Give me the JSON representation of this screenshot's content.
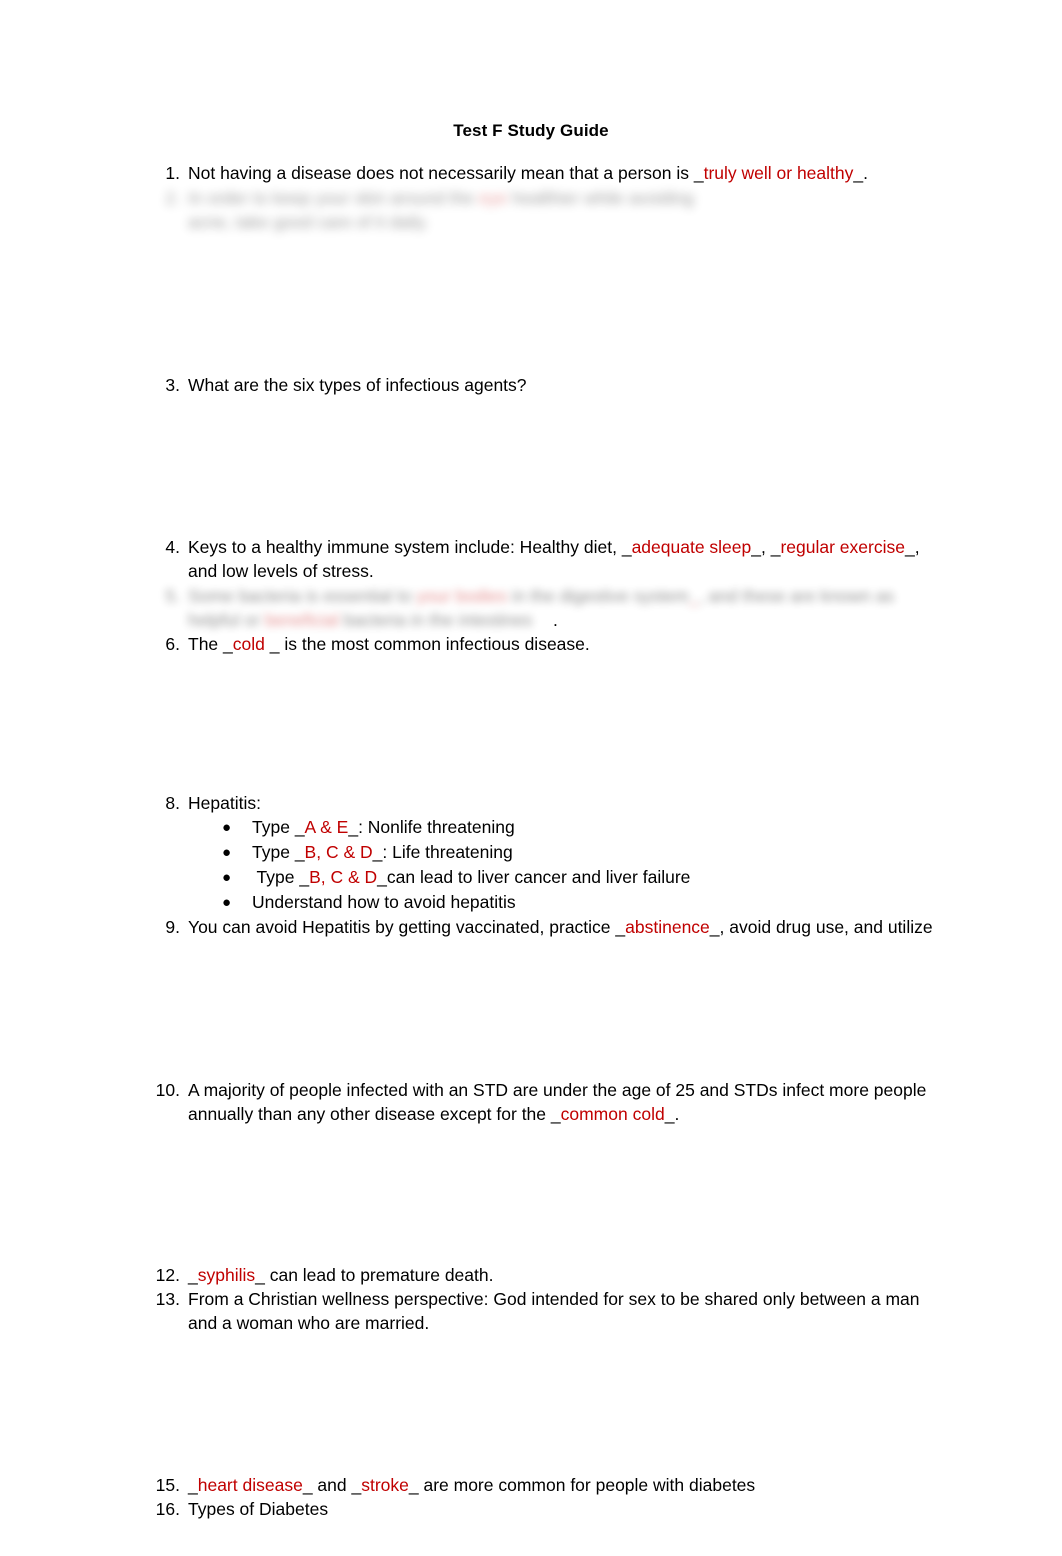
{
  "document": {
    "title": "Test F Study Guide",
    "accent_color": "#C00000",
    "text_color": "#000000",
    "background_color": "#FFFFFF"
  },
  "items": {
    "i1": {
      "number": "1.",
      "pre": "Not having a disease does not necessarily mean that a person is ",
      "u1": "_",
      "answer": "truly well or healthy",
      "u2": "_",
      "post": "."
    },
    "i2": {
      "number": "2.",
      "line1_pre": "In order to keep your skin around the ",
      "answer": "eye",
      "line1_post": " healthier while avoiding",
      "line2": "acne, take good care of it daily."
    },
    "i3": {
      "number": "3.",
      "text": "What are the six types of infectious agents?"
    },
    "i4": {
      "number": "4.",
      "pre": "Keys to a healthy immune system include: Healthy diet, ",
      "u1": "_",
      "answer1": "adequate sleep",
      "u2": "_, _",
      "answer2": "regular exercise",
      "u3": "_",
      "post": ",",
      "line2": "and low levels of stress."
    },
    "i5": {
      "number": "5.",
      "line1_pre": "Some bacteria is essential to ",
      "answer1": "your bodies",
      "line1_mid": " in the digestive system",
      "answer2": "_",
      "line1_post": ", and these are known as",
      "line2_pre": "helpful or ",
      "answer3": "beneficial",
      "line2_post": " bacteria in the intestines",
      "tail": "."
    },
    "i6": {
      "number": "6.",
      "pre": "The ",
      "u1": "_",
      "answer": "cold",
      "u2": " _",
      "post": " is the most common infectious disease."
    },
    "i8": {
      "number": "8.",
      "text": "Hepatitis:",
      "bullets": [
        {
          "pre": "Type ",
          "u1": "_",
          "answer": "A & E",
          "u2": "_",
          "post": ": Nonlife threatening"
        },
        {
          "pre": "Type ",
          "u1": "_",
          "answer": "B, C & D",
          "u2": "_",
          "post": ": Life threatening"
        },
        {
          "pre": " Type ",
          "u1": "_",
          "answer": "B, C & D",
          "u2": "_",
          "post": "can lead to liver cancer and liver failure"
        },
        {
          "pre": "Understand how to avoid hepatitis",
          "u1": "",
          "answer": "",
          "u2": "",
          "post": ""
        }
      ]
    },
    "i9": {
      "number": "9.",
      "pre": "You can avoid Hepatitis by getting vaccinated, practice ",
      "u1": "_",
      "answer": "abstinence",
      "u2": "_",
      "post": ", avoid drug use, and utilize"
    },
    "i10": {
      "number": "10.",
      "line1": "A majority of people infected with an STD are under the age of 25 and STDs infect more people",
      "line2_pre": "annually than any other disease except for the ",
      "u1": "_",
      "answer": "common cold",
      "u2": "_",
      "post": "."
    },
    "i12": {
      "number": "12.",
      "u1": "_",
      "answer": "syphilis",
      "u2": "_",
      "post": " can lead to premature death."
    },
    "i13": {
      "number": "13.",
      "line1": "From a Christian wellness perspective: God intended for sex to be shared only between a man",
      "line2": "and a woman who are married."
    },
    "i15": {
      "number": "15.",
      "u1": "_",
      "answer1": "heart disease",
      "u2": "_",
      "mid": " and ",
      "u3": "_",
      "answer2": "stroke",
      "u4": "_",
      "post": " are more common for people with diabetes"
    },
    "i16": {
      "number": "16.",
      "text": "Types of Diabetes"
    }
  }
}
